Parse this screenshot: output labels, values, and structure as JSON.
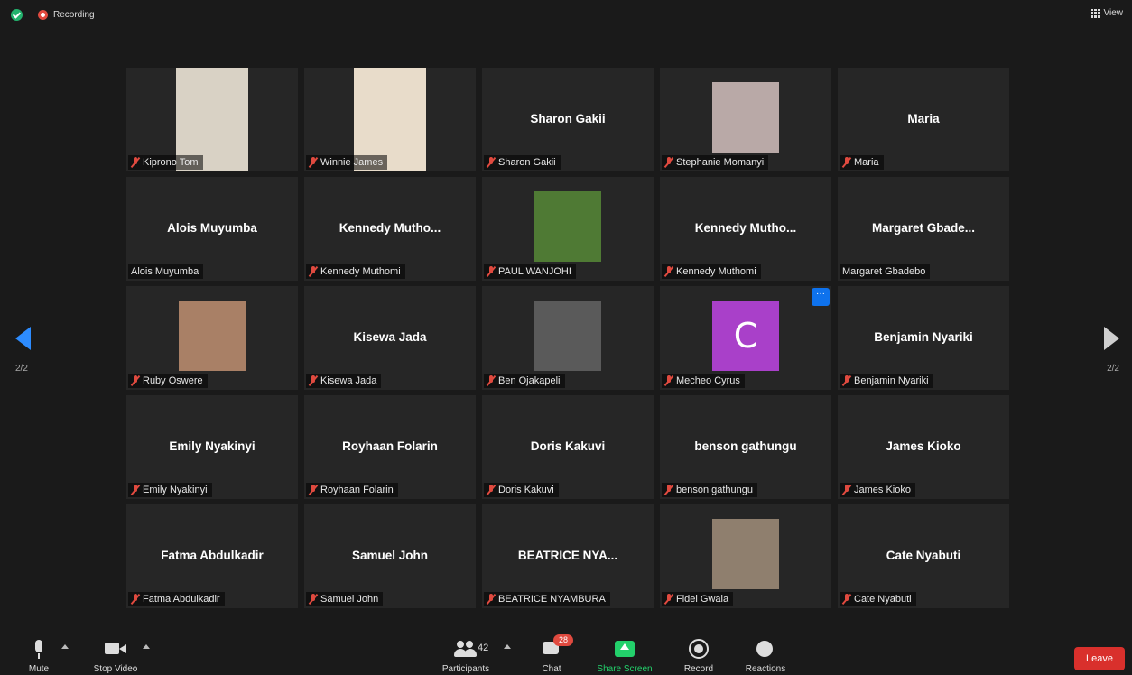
{
  "topbar": {
    "recording_label": "Recording",
    "view_label": "View"
  },
  "pagination": {
    "left": "2/2",
    "right": "2/2"
  },
  "tiles": [
    {
      "title": "",
      "nameplate": "Kiprono Tom",
      "photo": true,
      "photo_color": "#d9d2c5"
    },
    {
      "title": "",
      "nameplate": "Winnie James",
      "photo": true,
      "photo_color": "#e8dcca"
    },
    {
      "title": "Sharon Gakii",
      "nameplate": "Sharon Gakii",
      "photo": false
    },
    {
      "title": "",
      "nameplate": "Stephanie Momanyi",
      "photo": true,
      "photo_small": true,
      "photo_color": "#b9a9a7"
    },
    {
      "title": "Maria",
      "nameplate": "Maria",
      "photo": false
    },
    {
      "title": "Alois Muyumba",
      "nameplate": "Alois Muyumba",
      "photo": false,
      "unmuted": true
    },
    {
      "title": "Kennedy  Mutho...",
      "nameplate": "Kennedy Muthomi",
      "photo": false
    },
    {
      "title": "",
      "nameplate": "PAUL WANJOHI",
      "photo": true,
      "photo_small": true,
      "photo_color": "#4f7a34"
    },
    {
      "title": "Kennedy  Mutho...",
      "nameplate": "Kennedy Muthomi",
      "photo": false
    },
    {
      "title": "Margaret  Gbade...",
      "nameplate": "Margaret Gbadebo",
      "photo": false,
      "unmuted": true
    },
    {
      "title": "",
      "nameplate": "Ruby Oswere",
      "photo": true,
      "photo_small": true,
      "photo_color": "#a98066"
    },
    {
      "title": "Kisewa Jada",
      "nameplate": "Kisewa Jada",
      "photo": false
    },
    {
      "title": "",
      "nameplate": "Ben Ojakapeli",
      "photo": true,
      "photo_small": true,
      "photo_color": "#5a5a5a"
    },
    {
      "title": "",
      "nameplate": "Mecheo Cyrus",
      "avatar_letter": "C",
      "more": "···"
    },
    {
      "title": "Benjamin Nyariki",
      "nameplate": "Benjamin Nyariki",
      "photo": false
    },
    {
      "title": "Emily Nyakinyi",
      "nameplate": "Emily Nyakinyi",
      "photo": false
    },
    {
      "title": "Royhaan Folarin",
      "nameplate": "Royhaan Folarin",
      "photo": false
    },
    {
      "title": "Doris Kakuvi",
      "nameplate": "Doris Kakuvi",
      "photo": false
    },
    {
      "title": "benson gathungu",
      "nameplate": "benson gathungu",
      "photo": false
    },
    {
      "title": "James Kioko",
      "nameplate": "James Kioko",
      "photo": false
    },
    {
      "title": "Fatma Abdulkadir",
      "nameplate": "Fatma Abdulkadir",
      "photo": false
    },
    {
      "title": "Samuel John",
      "nameplate": "Samuel John",
      "photo": false
    },
    {
      "title": "BEATRICE NYA...",
      "nameplate": "BEATRICE NYAMBURA",
      "photo": false
    },
    {
      "title": "",
      "nameplate": "Fidel Gwala",
      "photo": true,
      "photo_small": true,
      "photo_color": "#8f7f6e"
    },
    {
      "title": "Cate Nyabuti",
      "nameplate": "Cate Nyabuti",
      "photo": false
    }
  ],
  "toolbar": {
    "mute": "Mute",
    "stop_video": "Stop Video",
    "participants": "Participants",
    "participants_count": "42",
    "chat": "Chat",
    "chat_badge": "28",
    "share_screen": "Share Screen",
    "record": "Record",
    "reactions": "Reactions",
    "leave": "Leave"
  },
  "colors": {
    "accent": "#2d8cff",
    "share": "#23d06b",
    "leave": "#d9302c",
    "recording": "#e04a3f"
  }
}
